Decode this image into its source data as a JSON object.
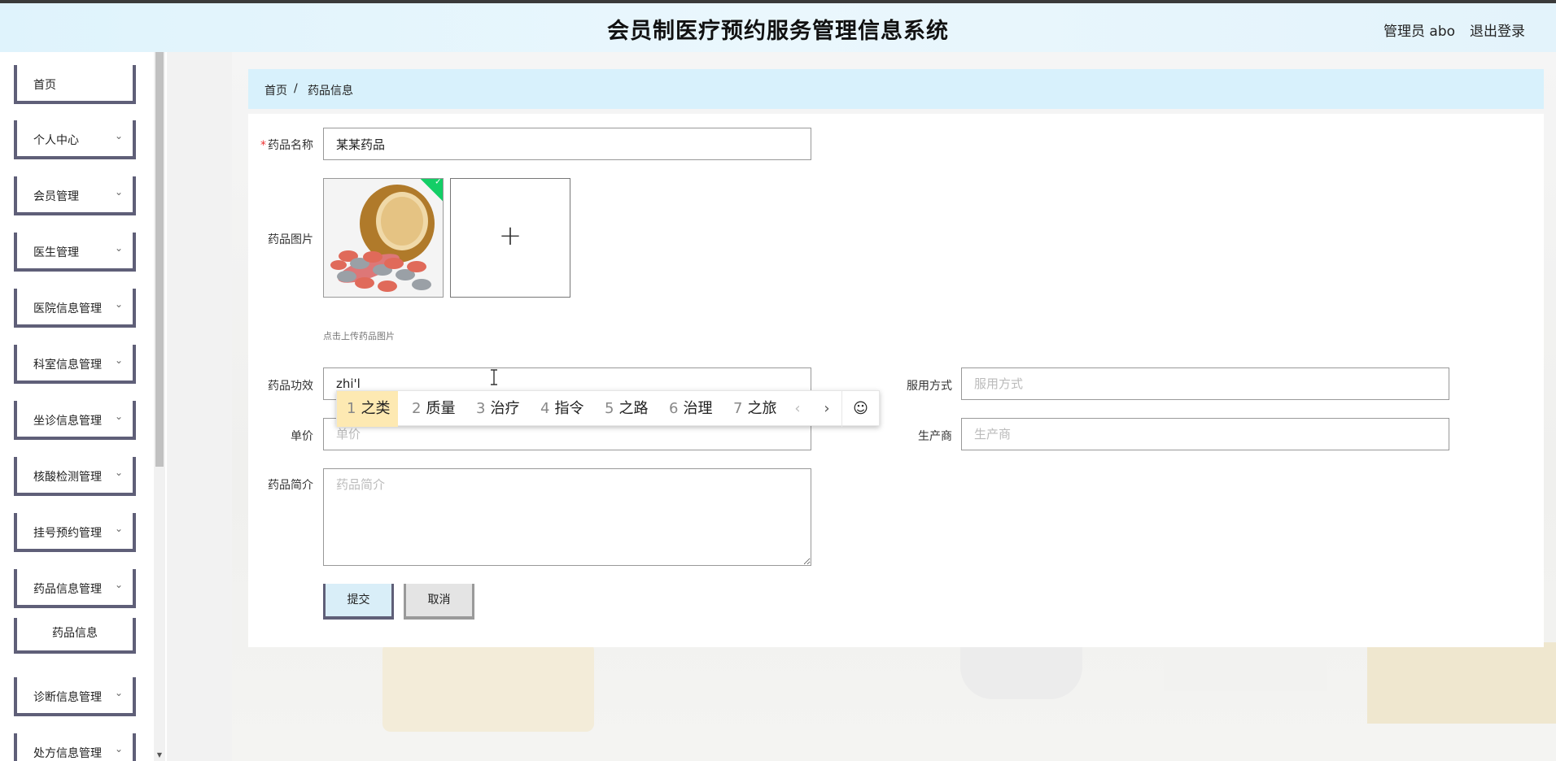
{
  "header": {
    "title": "会员制医疗预约服务管理信息系统",
    "user": "管理员 abo",
    "logout": "退出登录"
  },
  "sidebar": {
    "items": [
      {
        "label": "首页",
        "has_children": false
      },
      {
        "label": "个人中心",
        "has_children": true
      },
      {
        "label": "会员管理",
        "has_children": true
      },
      {
        "label": "医生管理",
        "has_children": true
      },
      {
        "label": "医院信息管理",
        "has_children": true
      },
      {
        "label": "科室信息管理",
        "has_children": true
      },
      {
        "label": "坐诊信息管理",
        "has_children": true
      },
      {
        "label": "核酸检测管理",
        "has_children": true
      },
      {
        "label": "挂号预约管理",
        "has_children": true
      },
      {
        "label": "药品信息管理",
        "has_children": true
      },
      {
        "label": "诊断信息管理",
        "has_children": true
      },
      {
        "label": "处方信息管理",
        "has_children": true
      }
    ],
    "sub_item": "药品信息"
  },
  "breadcrumb": {
    "home": "首页",
    "sep": "/",
    "current": "药品信息"
  },
  "form": {
    "name_label": "药品名称",
    "name_value": "某某药品",
    "image_label": "药品图片",
    "image_tip": "点击上传药品图片",
    "effect_label": "药品功效",
    "effect_value": "zhi'l",
    "usage_label": "服用方式",
    "usage_placeholder": "服用方式",
    "price_label": "单价",
    "price_placeholder": "单价",
    "maker_label": "生产商",
    "maker_placeholder": "生产商",
    "intro_label": "药品简介",
    "intro_placeholder": "药品简介",
    "submit": "提交",
    "cancel": "取消"
  },
  "ime": {
    "candidates": [
      {
        "n": "1",
        "text": "之类"
      },
      {
        "n": "2",
        "text": "质量"
      },
      {
        "n": "3",
        "text": "治疗"
      },
      {
        "n": "4",
        "text": "指令"
      },
      {
        "n": "5",
        "text": "之路"
      },
      {
        "n": "6",
        "text": "治理"
      },
      {
        "n": "7",
        "text": "之旅"
      }
    ],
    "prev": "‹",
    "next": "›",
    "emoji": "☺"
  },
  "colors": {
    "accent": "#d8f1fc",
    "sidebar_border": "#5f5f78",
    "success": "#13ce66",
    "ime_selected": "#fde9b2"
  }
}
